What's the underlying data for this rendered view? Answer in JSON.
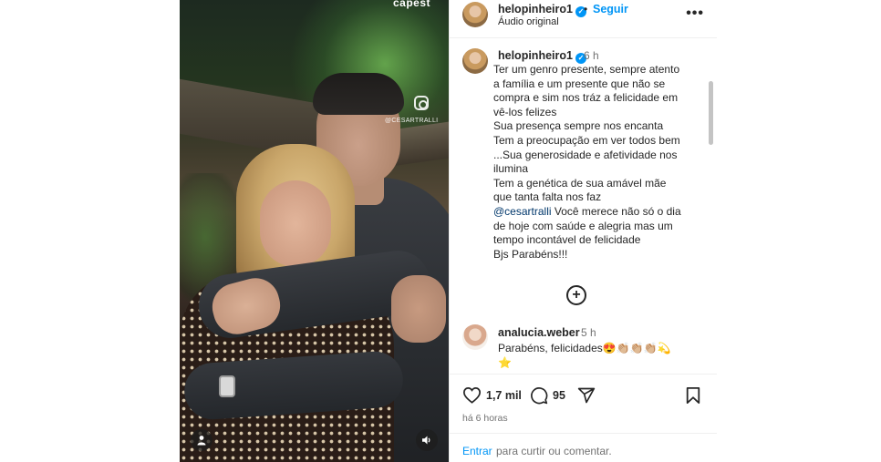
{
  "media": {
    "brand_text": "capest",
    "watermark_handle": "@CESARTRALLI",
    "icons": {
      "tag": "person-tag-icon",
      "mute": "speaker-icon",
      "watermark": "instagram-icon"
    }
  },
  "header": {
    "username": "helopinheiro1",
    "separator": "•",
    "follow_label": "Seguir",
    "audio_label": "Áudio original",
    "more_label": "•••"
  },
  "caption": {
    "username": "helopinheiro1",
    "time": "6 h",
    "lines": [
      "Ter um genro presente, sempre atento",
      "a família e um presente que não se",
      "compra e sim nos tráz a felicidade em",
      "vê-los felizes",
      "Sua presença sempre nos encanta",
      "Tem a preocupação em ver todos bem",
      "...Sua generosidade e afetividade nos",
      "ilumina",
      "Tem a genética de sua amável mãe",
      "que tanta falta nos faz"
    ],
    "mention": "@cesartralli",
    "mention_rest": " Você merece não só o dia",
    "lines_after": [
      "de hoje com saúde e alegria mas um",
      "tempo incontável de felicidade",
      "Bjs Parabéns!!!"
    ]
  },
  "comment": {
    "username": "analucia.weber",
    "time": "5 h",
    "text": "Parabéns, felicidades😍👏🏼👏🏼👏🏼💫",
    "text2": "⭐"
  },
  "actions": {
    "likes": "1,7 mil",
    "comments": "95",
    "time_ago": "há 6 horas",
    "enter_label": "Entrar",
    "enter_rest": "para curtir ou comentar."
  },
  "colors": {
    "link_blue": "#0095f6",
    "mention_blue": "#00376b",
    "muted": "#737373",
    "text": "#262626"
  }
}
